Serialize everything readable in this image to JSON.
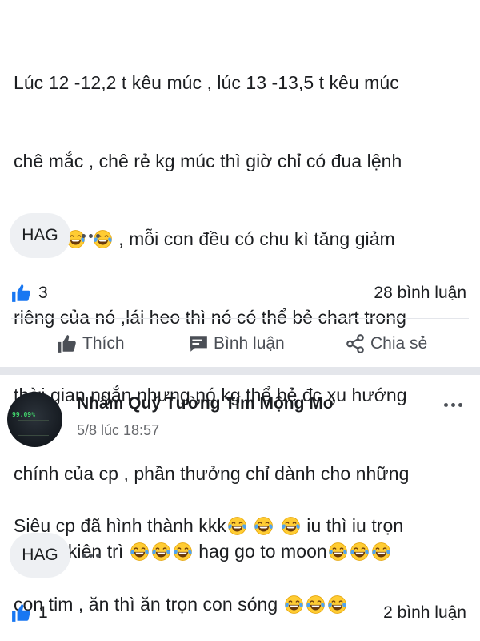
{
  "post1": {
    "lines": [
      "Lúc 12 -12,2 t kêu múc , lúc 13 -13,5 t kêu múc",
      "chê mắc , chê rẻ kg múc thì giờ chỉ có đua lệnh",
      "thui",
      ", mỗi con đều có chu kì tăng giảm",
      "riêng của nó ,lái heo thì nó có thể bẻ chart trong",
      "thời gian ngắn nhưng nó kg thể bẻ đc xu hướng",
      "chính của cp , phần thưởng chỉ dành cho những",
      "người kiên trì",
      "hag go to moon"
    ],
    "tag": "HAG",
    "like_count": "3",
    "comment_count": "28 bình luận",
    "actions": {
      "like": "Thích",
      "comment": "Bình luận",
      "share": "Chia sẻ"
    }
  },
  "post2": {
    "author": "Nhâm Quý Tường Tím Mộng Mơ",
    "timestamp": "5/8 lúc 18:57",
    "avatar_text": "99.09%",
    "lines": [
      "Siêu cp đã hình thành kkk",
      "iu thì iu trọn",
      "con tim , ăn thì ăn trọn con sóng"
    ],
    "tag": "HAG",
    "like_count": "1",
    "comment_count": "2 bình luận"
  },
  "icons": {
    "emoji": "face-with-tears-of-joy",
    "like": "thumbs-up-icon",
    "comment": "comment-icon",
    "share": "share-icon",
    "more": "more-dots-icon"
  },
  "colors": {
    "like_blue": "#1877f2",
    "text": "#1c1e21",
    "muted": "#65676b",
    "separator": "#e4e6eb"
  }
}
